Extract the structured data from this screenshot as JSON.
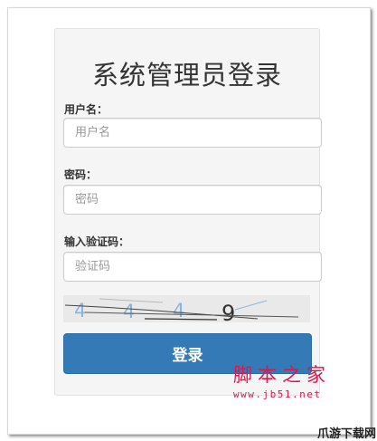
{
  "login": {
    "title": "系统管理员登录",
    "username_label": "用户名：",
    "username_placeholder": "用户名",
    "password_label": "密码：",
    "password_placeholder": "密码",
    "captcha_label": "输入验证码：",
    "captcha_placeholder": "验证码",
    "captcha_chars": [
      "4",
      "4",
      "4",
      "9"
    ],
    "login_button": "登录"
  },
  "watermark": {
    "title": "脚本之家",
    "url": "www.jb51.net"
  },
  "corner_logo": "爪游下载网",
  "colors": {
    "primary": "#337ab7",
    "panel_bg": "#f5f5f5",
    "captcha_digit_blue": "#8ab4e0",
    "captcha_digit_dark": "#333333",
    "watermark": "#d9184b"
  }
}
